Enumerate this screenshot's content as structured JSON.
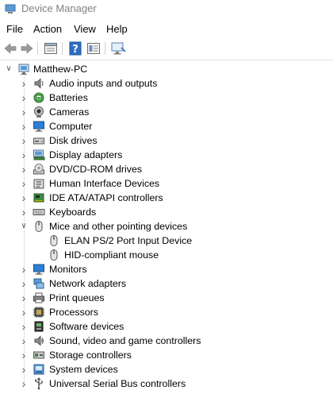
{
  "window": {
    "title": "Device Manager"
  },
  "menu": [
    "File",
    "Action",
    "View",
    "Help"
  ],
  "toolbar": {
    "buttons": [
      "back-arrow-icon",
      "forward-arrow-icon",
      "properties-icon",
      "help-icon",
      "view-icon",
      "scan-hardware-icon"
    ]
  },
  "tree": {
    "root": {
      "label": "Matthew-PC",
      "expanded": true
    },
    "items": [
      {
        "label": "Audio inputs and outputs",
        "icon": "speaker-icon"
      },
      {
        "label": "Batteries",
        "icon": "battery-icon"
      },
      {
        "label": "Cameras",
        "icon": "camera-icon"
      },
      {
        "label": "Computer",
        "icon": "computer-icon"
      },
      {
        "label": "Disk drives",
        "icon": "disk-drive-icon"
      },
      {
        "label": "Display adapters",
        "icon": "display-adapter-icon"
      },
      {
        "label": "DVD/CD-ROM drives",
        "icon": "dvd-icon"
      },
      {
        "label": "Human Interface Devices",
        "icon": "hid-icon"
      },
      {
        "label": "IDE ATA/ATAPI controllers",
        "icon": "ide-controller-icon"
      },
      {
        "label": "Keyboards",
        "icon": "keyboard-icon"
      },
      {
        "label": "Mice and other pointing devices",
        "icon": "mouse-icon",
        "expanded": true,
        "children": [
          {
            "label": "ELAN PS/2 Port Input Device",
            "icon": "mouse-icon"
          },
          {
            "label": "HID-compliant mouse",
            "icon": "mouse-icon"
          }
        ]
      },
      {
        "label": "Monitors",
        "icon": "monitor-icon"
      },
      {
        "label": "Network adapters",
        "icon": "network-adapter-icon"
      },
      {
        "label": "Print queues",
        "icon": "printer-icon"
      },
      {
        "label": "Processors",
        "icon": "processor-icon"
      },
      {
        "label": "Software devices",
        "icon": "software-device-icon"
      },
      {
        "label": "Sound, video and game controllers",
        "icon": "sound-icon"
      },
      {
        "label": "Storage controllers",
        "icon": "storage-controller-icon"
      },
      {
        "label": "System devices",
        "icon": "system-device-icon"
      },
      {
        "label": "Universal Serial Bus controllers",
        "icon": "usb-icon"
      }
    ]
  }
}
